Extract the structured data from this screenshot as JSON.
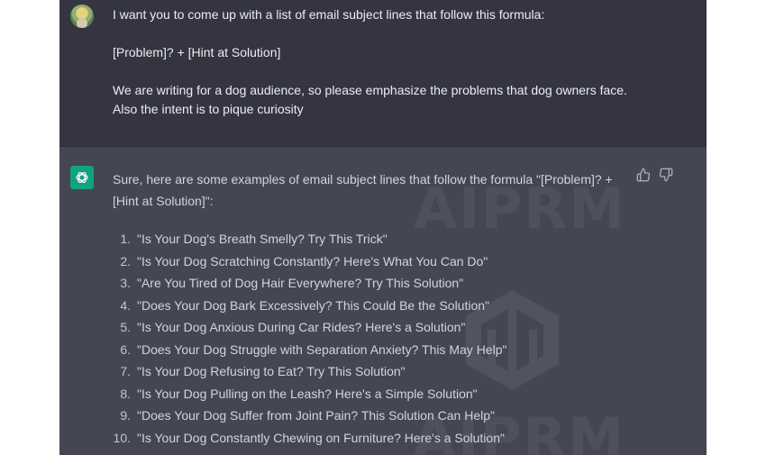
{
  "conversation": {
    "user_message": {
      "line1": "I want you to come up with a list of email subject lines that follow this formula:",
      "line2": "[Problem]? + [Hint at Solution]",
      "line3": "We are writing for a dog audience, so please emphasize the problems that dog owners face.",
      "line4": "Also the intent is to pique curiosity"
    },
    "assistant_message": {
      "intro": "Sure, here are some examples of email subject lines that follow the formula \"[Problem]? + [Hint at Solution]\":",
      "items": [
        {
          "num": "1.",
          "text": "\"Is Your Dog's Breath Smelly? Try This Trick\""
        },
        {
          "num": "2.",
          "text": "\"Is Your Dog Scratching Constantly? Here's What You Can Do\""
        },
        {
          "num": "3.",
          "text": "\"Are You Tired of Dog Hair Everywhere? Try This Solution\""
        },
        {
          "num": "4.",
          "text": "\"Does Your Dog Bark Excessively? This Could Be the Solution\""
        },
        {
          "num": "5.",
          "text": "\"Is Your Dog Anxious During Car Rides? Here's a Solution\""
        },
        {
          "num": "6.",
          "text": "\"Does Your Dog Struggle with Separation Anxiety? This May Help\""
        },
        {
          "num": "7.",
          "text": "\"Is Your Dog Refusing to Eat? Try This Solution\""
        },
        {
          "num": "8.",
          "text": "\"Is Your Dog Pulling on the Leash? Here's a Simple Solution\""
        },
        {
          "num": "9.",
          "text": "\"Does Your Dog Suffer from Joint Pain? This Solution Can Help\""
        },
        {
          "num": "10.",
          "text": "\"Is Your Dog Constantly Chewing on Furniture? Here's a Solution\""
        }
      ]
    }
  },
  "watermark": {
    "text_top": "AIPRM",
    "text_bottom": "AIPRM"
  },
  "icons": {
    "user_avatar": "user-avatar",
    "assistant_avatar": "openai-logo-icon",
    "thumbs_up": "thumbs-up-icon",
    "thumbs_down": "thumbs-down-icon"
  },
  "colors": {
    "user_bg": "#343541",
    "assistant_bg": "#444654",
    "bot_avatar": "#10a37f",
    "text": "#ececf1"
  }
}
